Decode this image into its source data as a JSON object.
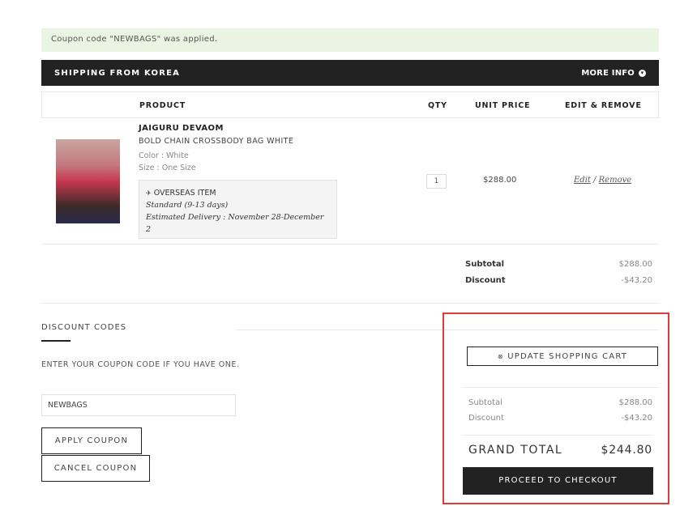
{
  "notice": "Coupon code \"NEWBAGS\" was applied.",
  "shipping": {
    "title": "SHIPPING FROM KOREA",
    "more_info": "MORE INFO"
  },
  "table": {
    "headers": {
      "product": "PRODUCT",
      "qty": "QTY",
      "unit_price": "UNIT PRICE",
      "edit_remove": "EDIT & REMOVE"
    }
  },
  "item": {
    "brand": "JAIGURU DEVAOM",
    "name": "BOLD CHAIN CROSSBODY BAG WHITE",
    "color": "Color : White",
    "size": "Size : One Size",
    "ship_label": "OVERSEAS ITEM",
    "ship_method": "Standard (9-13 days)",
    "ship_est": "Estimated Delivery : November 28-December 2",
    "qty": "1",
    "price": "$288.00",
    "edit": "Edit",
    "sep": " / ",
    "remove": "Remove"
  },
  "totals_top": {
    "subtotal_label": "Subtotal",
    "subtotal": "$288.00",
    "discount_label": "Discount",
    "discount": "-$43.20"
  },
  "discount_codes": {
    "title": "DISCOUNT CODES",
    "help": "ENTER YOUR COUPON CODE IF YOU HAVE ONE.",
    "value": "NEWBAGS",
    "apply": "APPLY COUPON",
    "cancel": "CANCEL COUPON"
  },
  "summary": {
    "update": "UPDATE SHOPPING CART",
    "subtotal_label": "Subtotal",
    "subtotal": "$288.00",
    "discount_label": "Discount",
    "discount": "-$43.20",
    "grand_label": "GRAND TOTAL",
    "grand": "$244.80",
    "checkout": "PROCEED TO CHECKOUT"
  },
  "colors": {
    "highlight": "#e03c3c",
    "dark": "#222222",
    "notice_bg": "#eaf4e2"
  }
}
